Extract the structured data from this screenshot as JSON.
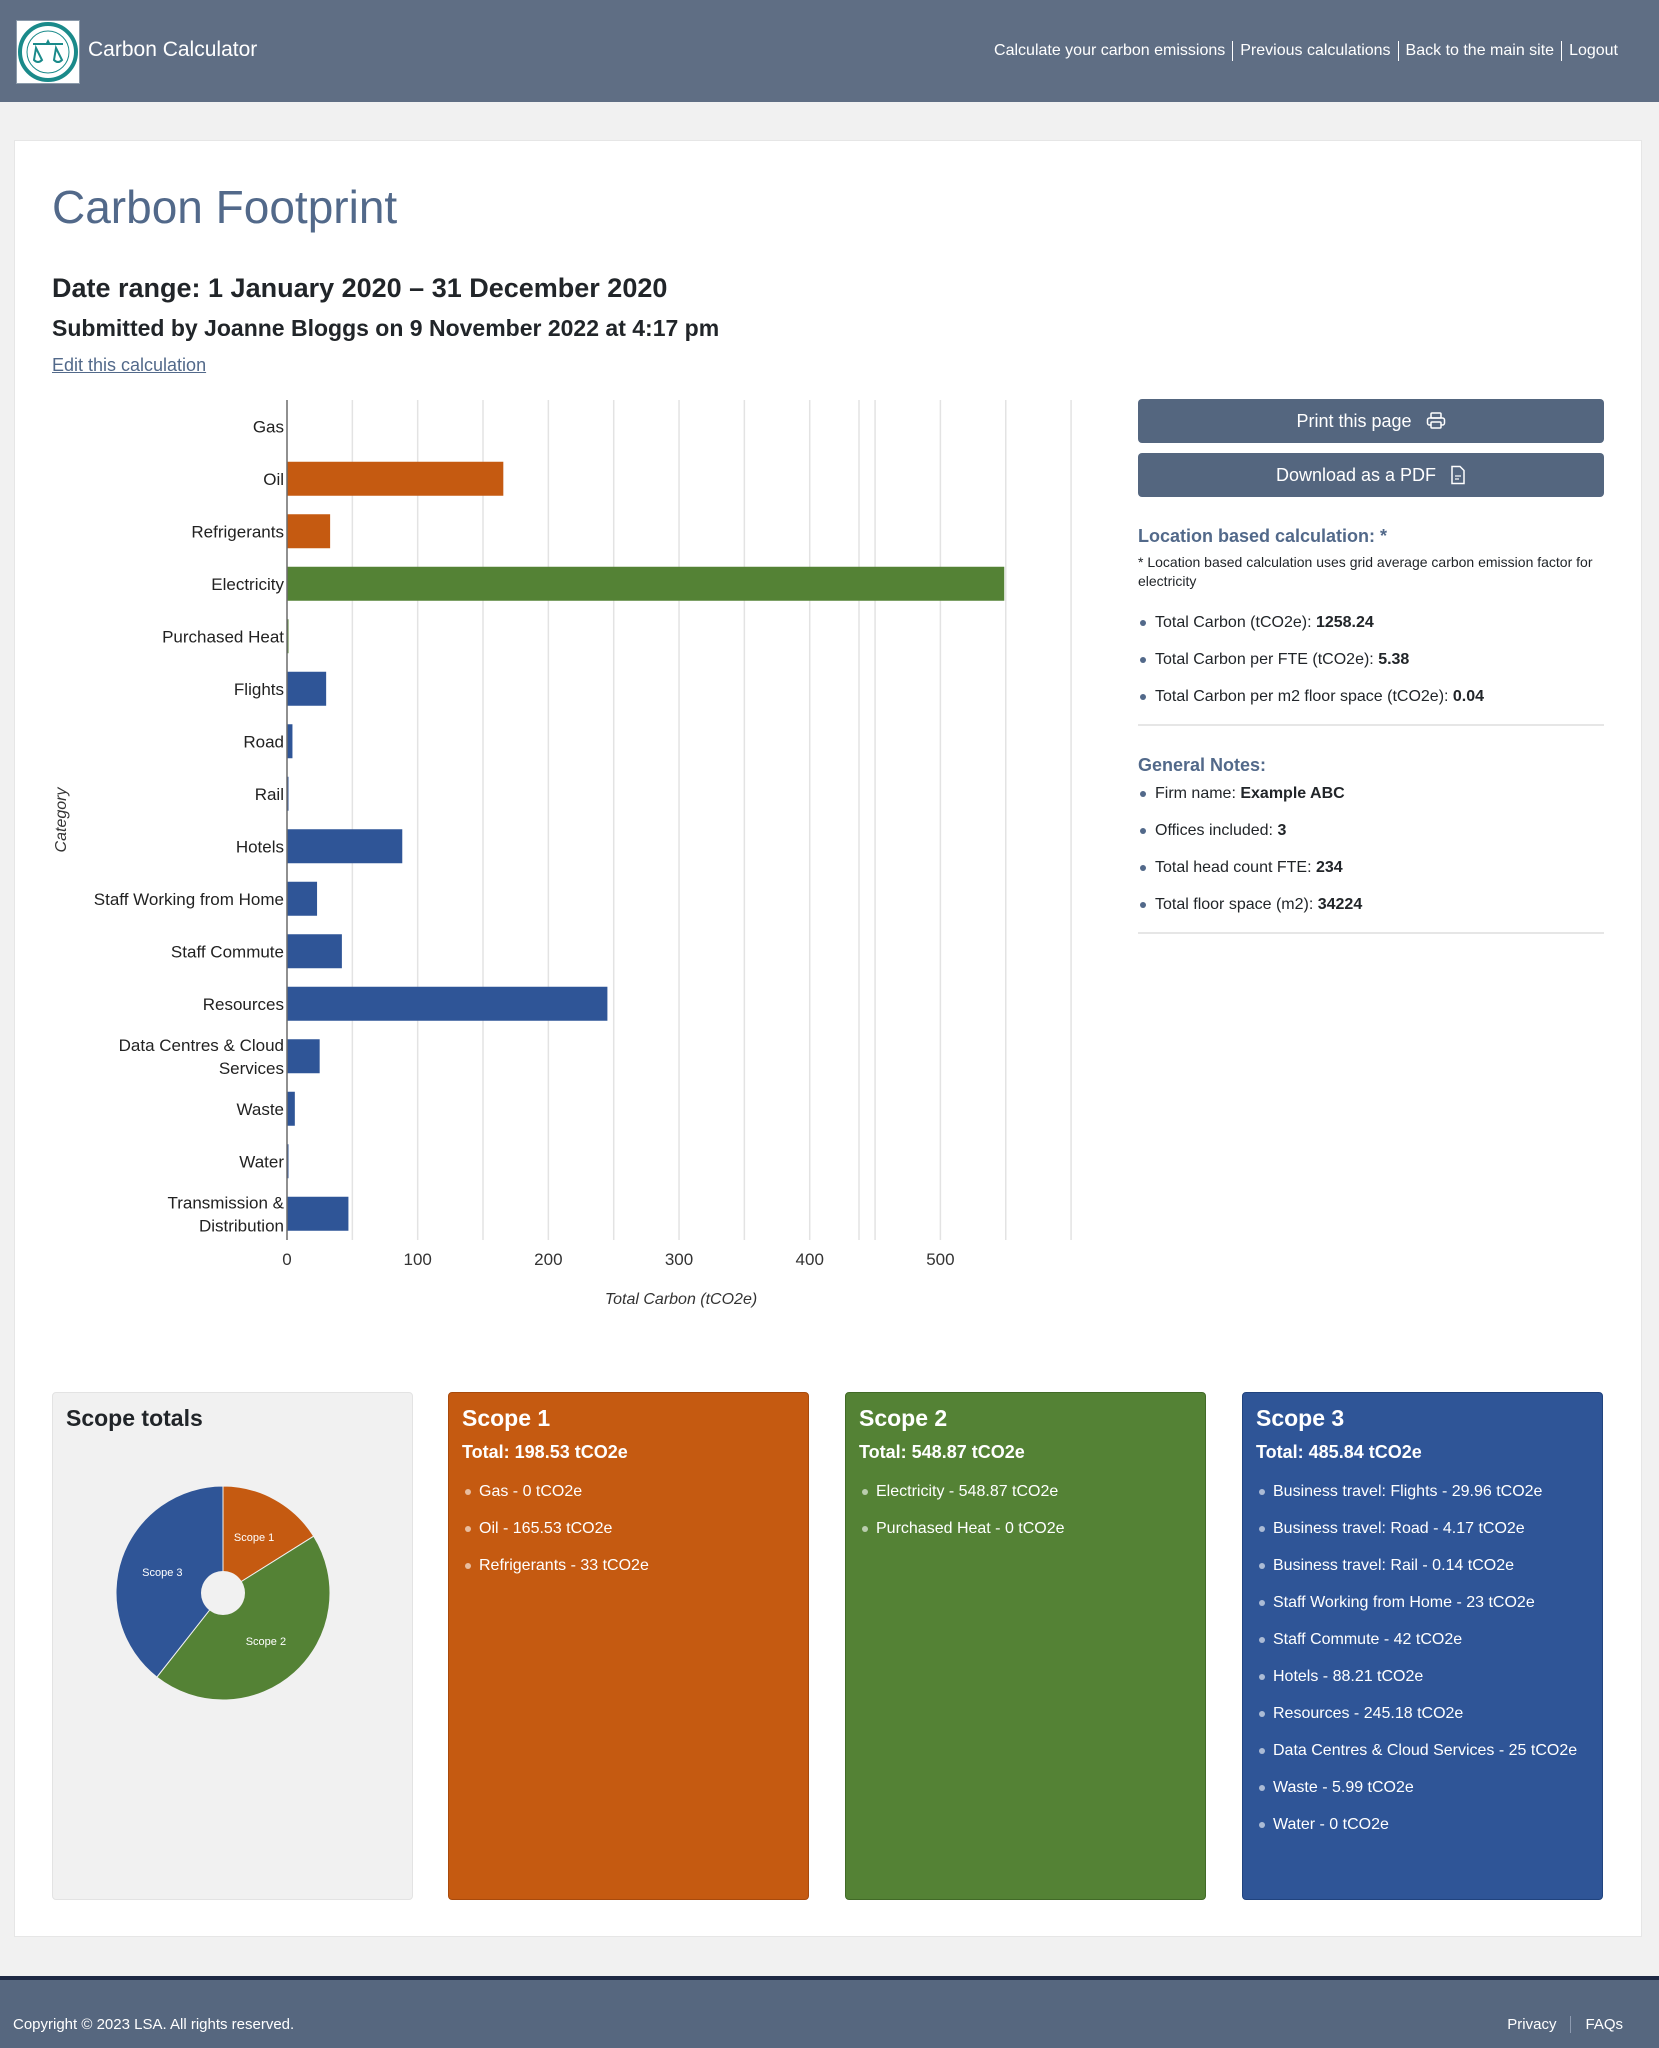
{
  "header": {
    "brand": "Carbon Calculator",
    "logo_alt": "The General Council of the Bar - Justice for All",
    "nav": [
      {
        "label": "Calculate your carbon emissions"
      },
      {
        "label": "Previous calculations"
      },
      {
        "label": "Back to the main site"
      },
      {
        "label": "Logout"
      }
    ]
  },
  "main": {
    "title": "Carbon Footprint",
    "date_range": "Date range: 1 January 2020 – 31 December 2020",
    "submitted": "Submitted by Joanne Bloggs on 9 November 2022 at 4:17 pm",
    "edit_link": "Edit this calculation"
  },
  "actions": {
    "print_label": "Print this page",
    "pdf_label": "Download as a PDF"
  },
  "location": {
    "heading": "Location based calculation: *",
    "note": "* Location based calculation uses grid average carbon emission factor for electricity",
    "items": [
      {
        "label": "Total Carbon (tCO2e): ",
        "value": "1258.24"
      },
      {
        "label": "Total Carbon per FTE (tCO2e): ",
        "value": "5.38"
      },
      {
        "label": "Total Carbon per m2 floor space (tCO2e): ",
        "value": "0.04"
      }
    ]
  },
  "general": {
    "heading": "General Notes:",
    "items": [
      {
        "label": "Firm name: ",
        "value": "Example ABC"
      },
      {
        "label": "Offices included: ",
        "value": "3"
      },
      {
        "label": "Total head count FTE: ",
        "value": "234"
      },
      {
        "label": "Total floor space (m2): ",
        "value": "34224"
      }
    ]
  },
  "colors": {
    "scope1": "#c55a11",
    "scope2": "#548235",
    "scope3": "#2f5597",
    "accent": "#52698a"
  },
  "chart_data": [
    {
      "type": "bar",
      "orientation": "horizontal",
      "title": "",
      "xlabel": "Total Carbon (tCO2e)",
      "ylabel": "Category",
      "xlim": [
        0,
        630
      ],
      "xticks": [
        0,
        100,
        200,
        300,
        400,
        500
      ],
      "grid": true,
      "categories": [
        "Gas",
        "Oil",
        "Refrigerants",
        "Electricity",
        "Purchased Heat",
        "Flights",
        "Road",
        "Rail",
        "Hotels",
        "Staff Working from Home",
        "Staff Commute",
        "Resources",
        "Data Centres & Cloud Services",
        "Waste",
        "Water",
        "Transmission & Distribution"
      ],
      "category_lines": [
        [
          "Gas"
        ],
        [
          "Oil"
        ],
        [
          "Refrigerants"
        ],
        [
          "Electricity"
        ],
        [
          "Purchased Heat"
        ],
        [
          "Flights"
        ],
        [
          "Road"
        ],
        [
          "Rail"
        ],
        [
          "Hotels"
        ],
        [
          "Staff Working from Home"
        ],
        [
          "Staff Commute"
        ],
        [
          "Resources"
        ],
        [
          "Data Centres & Cloud",
          "Services"
        ],
        [
          "Waste"
        ],
        [
          "Water"
        ],
        [
          "Transmission &",
          "Distribution"
        ]
      ],
      "values": [
        0,
        165.53,
        33,
        548.87,
        0,
        29.96,
        4.17,
        0.14,
        88.21,
        23,
        42,
        245.18,
        25,
        5.99,
        0,
        47
      ],
      "scopes": [
        1,
        1,
        1,
        2,
        2,
        3,
        3,
        3,
        3,
        3,
        3,
        3,
        3,
        3,
        3,
        3
      ]
    },
    {
      "type": "pie",
      "title": "Scope totals",
      "labels": [
        "Scope 1",
        "Scope 2",
        "Scope 3"
      ],
      "values": [
        198.53,
        548.87,
        485.84
      ],
      "donut_hole": true
    }
  ],
  "scopes": [
    {
      "title": "Scope 1",
      "total": "Total: 198.53 tCO2e",
      "items": [
        "Gas - 0 tCO2e",
        "Oil - 165.53 tCO2e",
        "Refrigerants - 33 tCO2e"
      ]
    },
    {
      "title": "Scope 2",
      "total": "Total: 548.87 tCO2e",
      "items": [
        "Electricity - 548.87 tCO2e",
        "Purchased Heat - 0 tCO2e"
      ]
    },
    {
      "title": "Scope 3",
      "total": "Total: 485.84 tCO2e",
      "items": [
        "Business travel: Flights - 29.96 tCO2e",
        "Business travel: Road - 4.17 tCO2e",
        "Business travel: Rail - 0.14 tCO2e",
        "Staff Working from Home - 23 tCO2e",
        "Staff Commute - 42 tCO2e",
        "Hotels - 88.21 tCO2e",
        "Resources - 245.18 tCO2e",
        "Data Centres & Cloud Services - 25 tCO2e",
        "Waste - 5.99 tCO2e",
        "Water - 0 tCO2e"
      ]
    }
  ],
  "footer": {
    "copyright": "Copyright © 2023 LSA. All rights reserved.",
    "links": [
      {
        "label": "Privacy"
      },
      {
        "label": "FAQs"
      }
    ]
  }
}
